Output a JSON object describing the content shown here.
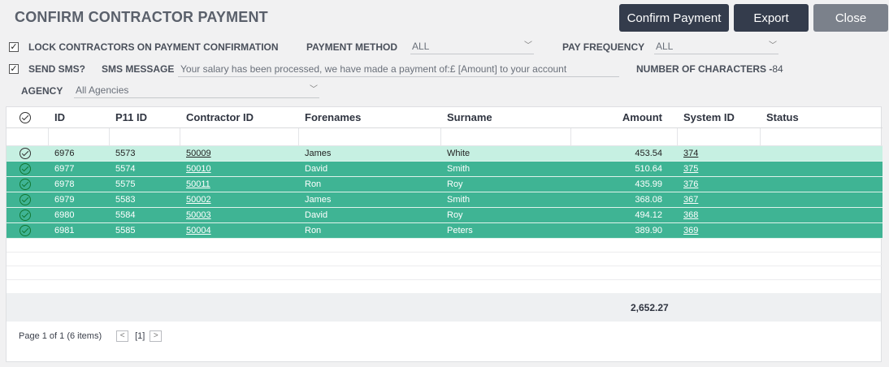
{
  "header": {
    "title": "CONFIRM CONTRACTOR PAYMENT",
    "confirm_label": "Confirm Payment",
    "export_label": "Export",
    "close_label": "Close"
  },
  "options": {
    "lock_label": "LOCK CONTRACTORS ON PAYMENT CONFIRMATION",
    "lock_checked": true,
    "payment_method_label": "PAYMENT METHOD",
    "payment_method_value": "ALL",
    "pay_frequency_label": "PAY FREQUENCY",
    "pay_frequency_value": "ALL",
    "send_sms_label": "SEND SMS?",
    "send_sms_checked": true,
    "sms_message_label": "SMS MESSAGE",
    "sms_message_value": "Your salary has been processed, we have made a payment of:£ [Amount] to your account",
    "char_count_label": "NUMBER OF CHARACTERS -",
    "char_count_value": "84",
    "agency_label": "AGENCY",
    "agency_value": "All Agencies"
  },
  "table": {
    "columns": [
      "ID",
      "P11 ID",
      "Contractor ID",
      "Forenames",
      "Surname",
      "Amount",
      "System ID",
      "Status"
    ],
    "rows": [
      {
        "id": "6976",
        "p11": "5573",
        "contractor": "50009",
        "forename": "James",
        "surname": "White",
        "amount": "453.54",
        "system": "374",
        "status": ""
      },
      {
        "id": "6977",
        "p11": "5574",
        "contractor": "50010",
        "forename": "David",
        "surname": "Smith",
        "amount": "510.64",
        "system": "375",
        "status": ""
      },
      {
        "id": "6978",
        "p11": "5575",
        "contractor": "50011",
        "forename": "Ron",
        "surname": "Roy",
        "amount": "435.99",
        "system": "376",
        "status": ""
      },
      {
        "id": "6979",
        "p11": "5583",
        "contractor": "50002",
        "forename": "James",
        "surname": "Smith",
        "amount": "368.08",
        "system": "367",
        "status": ""
      },
      {
        "id": "6980",
        "p11": "5584",
        "contractor": "50003",
        "forename": "David",
        "surname": "Roy",
        "amount": "494.12",
        "system": "368",
        "status": ""
      },
      {
        "id": "6981",
        "p11": "5585",
        "contractor": "50004",
        "forename": "Ron",
        "surname": "Peters",
        "amount": "389.90",
        "system": "369",
        "status": ""
      }
    ],
    "total_amount": "2,652.27"
  },
  "pager": {
    "summary": "Page 1 of 1 (6 items)",
    "current_page": "[1]"
  },
  "colors": {
    "selected_row": "#3fb494",
    "highlight_row": "#c6f0e2",
    "primary_button": "#343c4c",
    "close_button": "#7b818b"
  }
}
